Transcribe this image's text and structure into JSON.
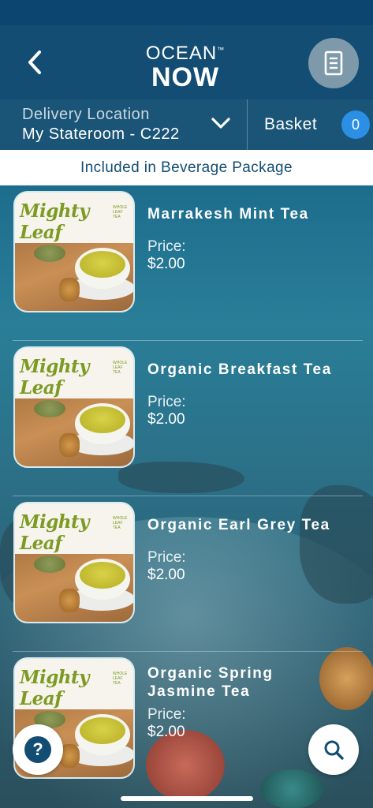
{
  "header": {
    "logo_line1": "OCEAN",
    "logo_line2": "NOW",
    "logo_tm": "™"
  },
  "delivery": {
    "label": "Delivery Location",
    "value": "My Stateroom - C222"
  },
  "basket": {
    "label": "Basket",
    "count": "0"
  },
  "banner": "Included in Beverage Package",
  "brand": {
    "name": "Mighty Leaf",
    "tagline": "WHOLE LEAF TEA"
  },
  "price_label": "Price:",
  "items": [
    {
      "title": "Marrakesh Mint Tea",
      "price": "$2.00"
    },
    {
      "title": "Organic Breakfast Tea",
      "price": "$2.00"
    },
    {
      "title": "Organic Earl Grey Tea",
      "price": "$2.00"
    },
    {
      "title": "Organic Spring Jasmine Tea",
      "price": "$2.00"
    }
  ],
  "help_label": "?",
  "icons": {
    "back": "chevron-left-icon",
    "orders": "receipt-icon",
    "delivery_dropdown": "chevron-down-icon",
    "help": "help-bubble-icon",
    "search": "search-icon"
  },
  "colors": {
    "header": "#134d73",
    "badge": "#2b8fe6",
    "brand_green": "#7d9a24"
  }
}
